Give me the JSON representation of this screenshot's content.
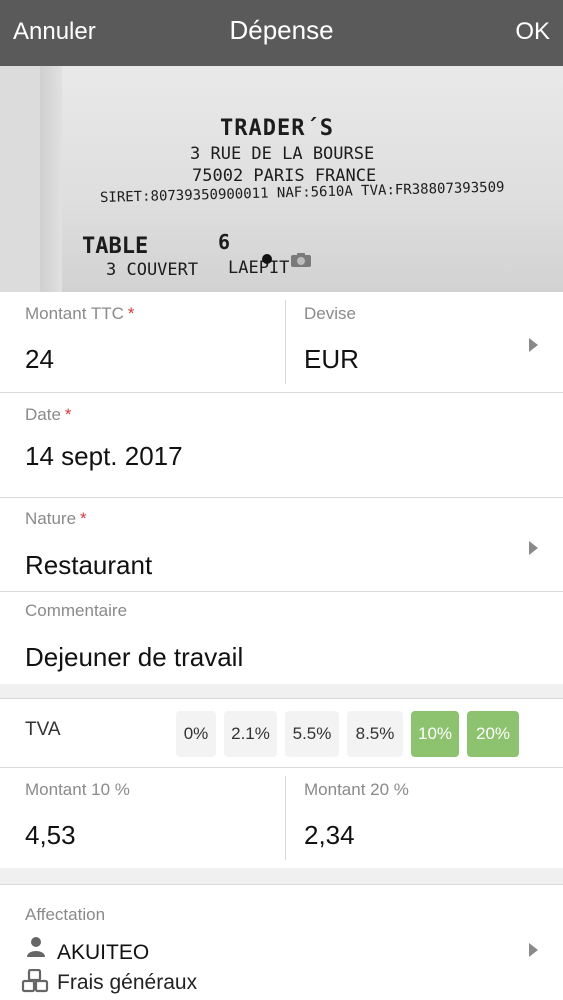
{
  "navbar": {
    "cancel_label": "Annuler",
    "title": "Dépense",
    "ok_label": "OK"
  },
  "receipt": {
    "merchant": "TRADER´S",
    "address_line1": "3 RUE DE LA BOURSE",
    "address_line2": "75002 PARIS FRANCE",
    "siret_line": "SIRET:80739350900011 NAF:5610A TVA:FR38807393509",
    "table_label": "TABLE",
    "table_number": "6",
    "couvert": "3 COUVERT",
    "server": "LAEPIT"
  },
  "amount": {
    "label": "Montant TTC",
    "value": "24"
  },
  "currency": {
    "label": "Devise",
    "value": "EUR"
  },
  "date": {
    "label": "Date",
    "value": "14 sept. 2017"
  },
  "nature": {
    "label": "Nature",
    "value": "Restaurant"
  },
  "comment": {
    "label": "Commentaire",
    "value": "Dejeuner de travail"
  },
  "required_marker": "*",
  "tva": {
    "label": "TVA",
    "rates": [
      {
        "label": "0%",
        "active": false
      },
      {
        "label": "2.1%",
        "active": false
      },
      {
        "label": "5.5%",
        "active": false
      },
      {
        "label": "8.5%",
        "active": false
      },
      {
        "label": "10%",
        "active": true
      },
      {
        "label": "20%",
        "active": true
      }
    ]
  },
  "amount_10": {
    "label": "Montant 10 %",
    "value": "4,53"
  },
  "amount_20": {
    "label": "Montant 20 %",
    "value": "2,34"
  },
  "assignment": {
    "label": "Affectation",
    "company": "AKUITEO",
    "cost_center": "Frais généraux"
  },
  "colors": {
    "header_bg": "#5a5a5a",
    "accent_green": "#8dc26f",
    "required_red": "#d23b3b"
  },
  "icons": {
    "person": "person-icon",
    "cubes": "cubes-icon",
    "chevron": "chevron-right-icon",
    "camera": "camera-icon"
  }
}
